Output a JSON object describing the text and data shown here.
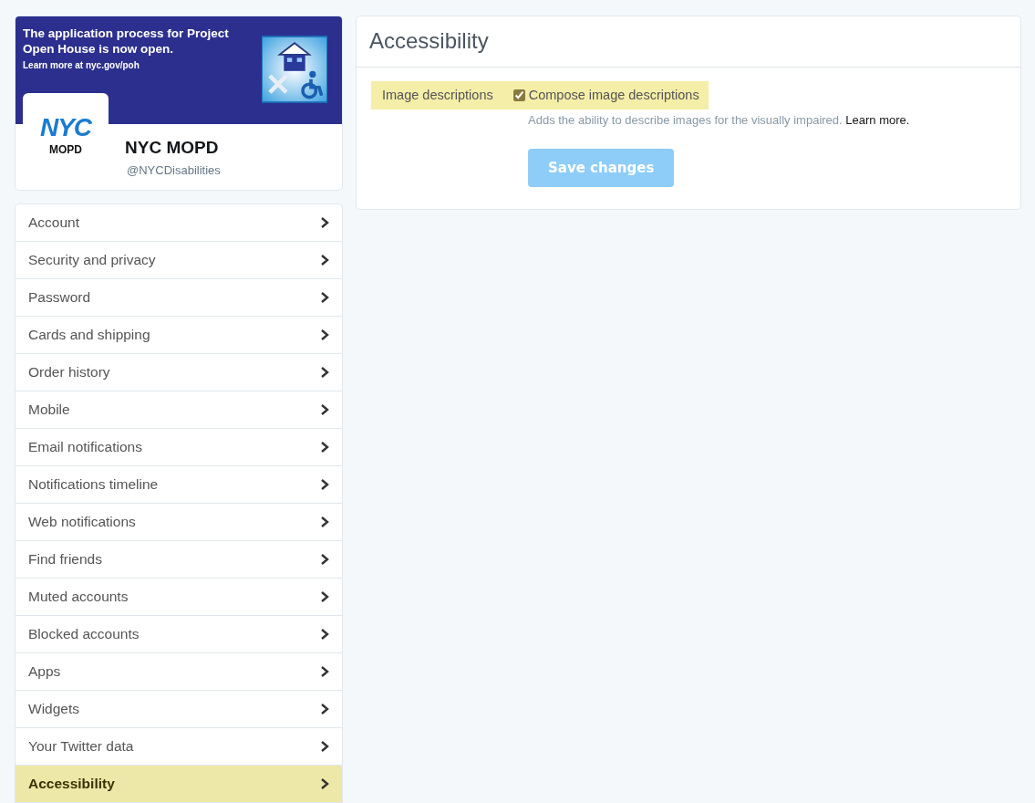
{
  "profile": {
    "banner": {
      "headline": "The application process for Project Open House is now open.",
      "link": "Learn more at nyc.gov/poh"
    },
    "avatar": {
      "logo_top": "NYC",
      "logo_bottom": "MOPD"
    },
    "name": "NYC MOPD",
    "handle": "@NYCDisabilities"
  },
  "sidebar": {
    "items": [
      {
        "label": "Account",
        "selected": false
      },
      {
        "label": "Security and privacy",
        "selected": false
      },
      {
        "label": "Password",
        "selected": false
      },
      {
        "label": "Cards and shipping",
        "selected": false
      },
      {
        "label": "Order history",
        "selected": false
      },
      {
        "label": "Mobile",
        "selected": false
      },
      {
        "label": "Email notifications",
        "selected": false
      },
      {
        "label": "Notifications timeline",
        "selected": false
      },
      {
        "label": "Web notifications",
        "selected": false
      },
      {
        "label": "Find friends",
        "selected": false
      },
      {
        "label": "Muted accounts",
        "selected": false
      },
      {
        "label": "Blocked accounts",
        "selected": false
      },
      {
        "label": "Apps",
        "selected": false
      },
      {
        "label": "Widgets",
        "selected": false
      },
      {
        "label": "Your Twitter data",
        "selected": false
      },
      {
        "label": "Accessibility",
        "selected": true
      }
    ]
  },
  "panel": {
    "title": "Accessibility",
    "setting": {
      "label": "Image descriptions",
      "option": "Compose image descriptions",
      "checked": true,
      "help": "Adds the ability to describe images for the visually impaired.",
      "help_link": "Learn more."
    },
    "save_button": {
      "label": "Save changes",
      "disabled": true
    }
  }
}
